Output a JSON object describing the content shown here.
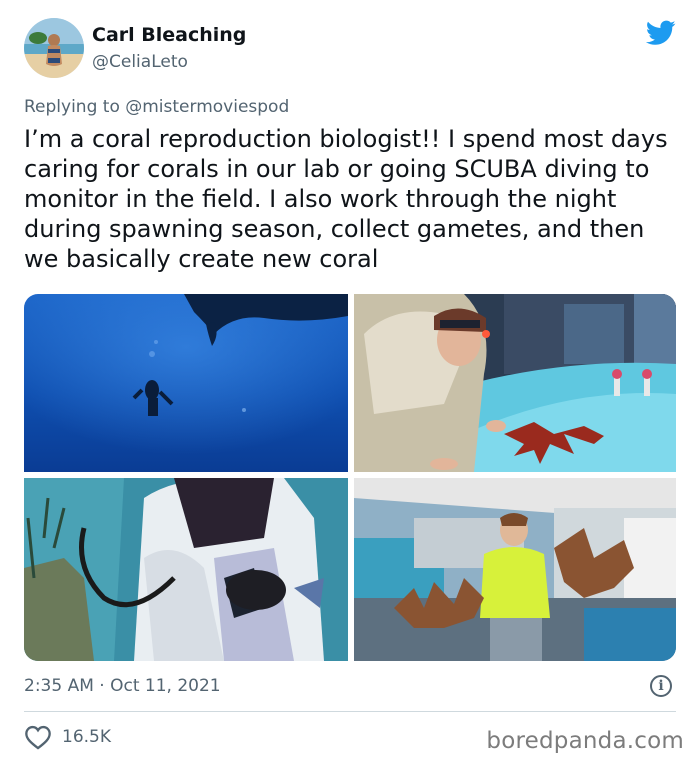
{
  "author": {
    "name": "Carl Bleaching",
    "handle": "@CeliaLeto"
  },
  "reply": {
    "prefix": "Replying to ",
    "mention": "@mistermoviespod"
  },
  "tweet": {
    "text": "I’m a coral reproduction biologist!! I spend most days caring for corals in our lab or going SCUBA diving to monitor in the field. I also work through the night during spawning season, collect gametes, and then we basically create new coral"
  },
  "meta": {
    "timestamp": "2:35 AM · Oct 11, 2021",
    "info_glyph": "i"
  },
  "actions": {
    "like_count": "16.5K"
  },
  "watermark": "boredpanda.com",
  "colors": {
    "twitter_blue": "#1d9bf0",
    "secondary_text": "#536471",
    "primary_text": "#0f1419"
  },
  "icons": [
    "twitter-bird-icon",
    "info-icon",
    "heart-icon"
  ]
}
